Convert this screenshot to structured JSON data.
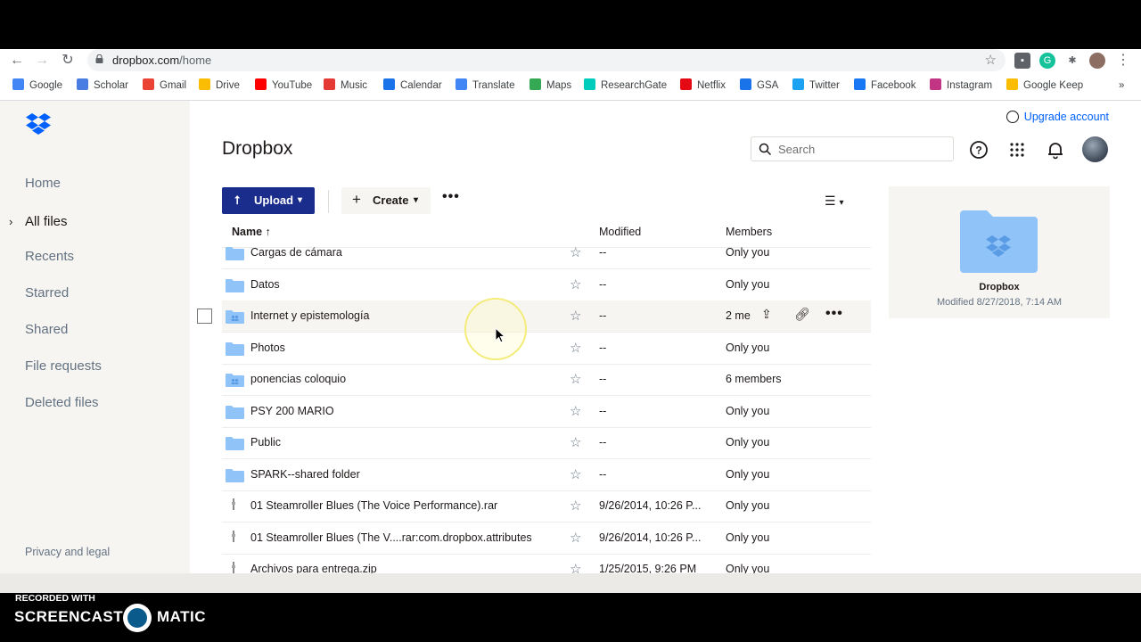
{
  "browser": {
    "url_host": "dropbox.com",
    "url_path": "/home",
    "bookmarks": [
      {
        "label": "Google",
        "icon": "google-icon",
        "color": "#4285f4"
      },
      {
        "label": "Scholar",
        "icon": "scholar-icon",
        "color": "#4a7de2"
      },
      {
        "label": "Gmail",
        "icon": "gmail-icon",
        "color": "#ea4335"
      },
      {
        "label": "Drive",
        "icon": "drive-icon",
        "color": "#fbbc04"
      },
      {
        "label": "YouTube",
        "icon": "youtube-icon",
        "color": "#ff0000"
      },
      {
        "label": "Music",
        "icon": "music-icon",
        "color": "#e53935"
      },
      {
        "label": "Calendar",
        "icon": "calendar-icon",
        "color": "#1a73e8"
      },
      {
        "label": "Translate",
        "icon": "translate-icon",
        "color": "#4285f4"
      },
      {
        "label": "Maps",
        "icon": "maps-icon",
        "color": "#34a853"
      },
      {
        "label": "ResearchGate",
        "icon": "researchgate-icon",
        "color": "#00ccbb"
      },
      {
        "label": "Netflix",
        "icon": "netflix-icon",
        "color": "#e50914"
      },
      {
        "label": "GSA",
        "icon": "gsa-icon",
        "color": "#1a73e8"
      },
      {
        "label": "Twitter",
        "icon": "twitter-icon",
        "color": "#1da1f2"
      },
      {
        "label": "Facebook",
        "icon": "facebook-icon",
        "color": "#1877f2"
      },
      {
        "label": "Instagram",
        "icon": "instagram-icon",
        "color": "#c13584"
      },
      {
        "label": "Google Keep",
        "icon": "keep-icon",
        "color": "#fbbc04"
      }
    ],
    "overflow": "»"
  },
  "sidebar": {
    "items": [
      {
        "label": "Home"
      },
      {
        "label": "All files"
      },
      {
        "label": "Recents"
      },
      {
        "label": "Starred"
      },
      {
        "label": "Shared"
      },
      {
        "label": "File requests"
      },
      {
        "label": "Deleted files"
      }
    ],
    "active_index": 1,
    "privacy": "Privacy and legal"
  },
  "header": {
    "title": "Dropbox",
    "upgrade": "Upgrade account",
    "search_placeholder": "Search"
  },
  "toolbar": {
    "upload": "Upload",
    "create": "Create"
  },
  "table": {
    "columns": {
      "name": "Name",
      "modified": "Modified",
      "members": "Members"
    },
    "rows": [
      {
        "name": "Cargas de cámara",
        "type": "folder",
        "modified": "--",
        "members": "Only you"
      },
      {
        "name": "Datos",
        "type": "folder",
        "modified": "--",
        "members": "Only you"
      },
      {
        "name": "Internet y epistemología",
        "type": "shared-folder",
        "modified": "--",
        "members": "2 me"
      },
      {
        "name": "Photos",
        "type": "folder",
        "modified": "--",
        "members": "Only you"
      },
      {
        "name": "ponencias coloquio",
        "type": "shared-folder",
        "modified": "--",
        "members": "6 members"
      },
      {
        "name": "PSY 200 MARIO",
        "type": "folder",
        "modified": "--",
        "members": "Only you"
      },
      {
        "name": "Public",
        "type": "folder",
        "modified": "--",
        "members": "Only you"
      },
      {
        "name": "SPARK--shared folder",
        "type": "folder",
        "modified": "--",
        "members": "Only you"
      },
      {
        "name": "01 Steamroller Blues (The Voice Performance).rar",
        "type": "file",
        "modified": "9/26/2014, 10:26 P...",
        "members": "Only you"
      },
      {
        "name": "01 Steamroller Blues (The V....rar:com.dropbox.attributes",
        "type": "file",
        "modified": "9/26/2014, 10:26 P...",
        "members": "Only you"
      },
      {
        "name": "Archivos para entrega.zip",
        "type": "file",
        "modified": "1/25/2015, 9:26 PM",
        "members": "Only you"
      }
    ],
    "hover_index": 2
  },
  "preview": {
    "name": "Dropbox",
    "modified": "Modified 8/27/2018, 7:14 AM"
  },
  "watermark": {
    "small": "RECORDED WITH",
    "word1": "SCREENCAST",
    "word2": "MATIC"
  },
  "colors": {
    "accent": "#0061fe",
    "upload_bg": "#1a2c8c",
    "folder": "#90c3f7",
    "sidebar_bg": "#f7f5f2"
  }
}
